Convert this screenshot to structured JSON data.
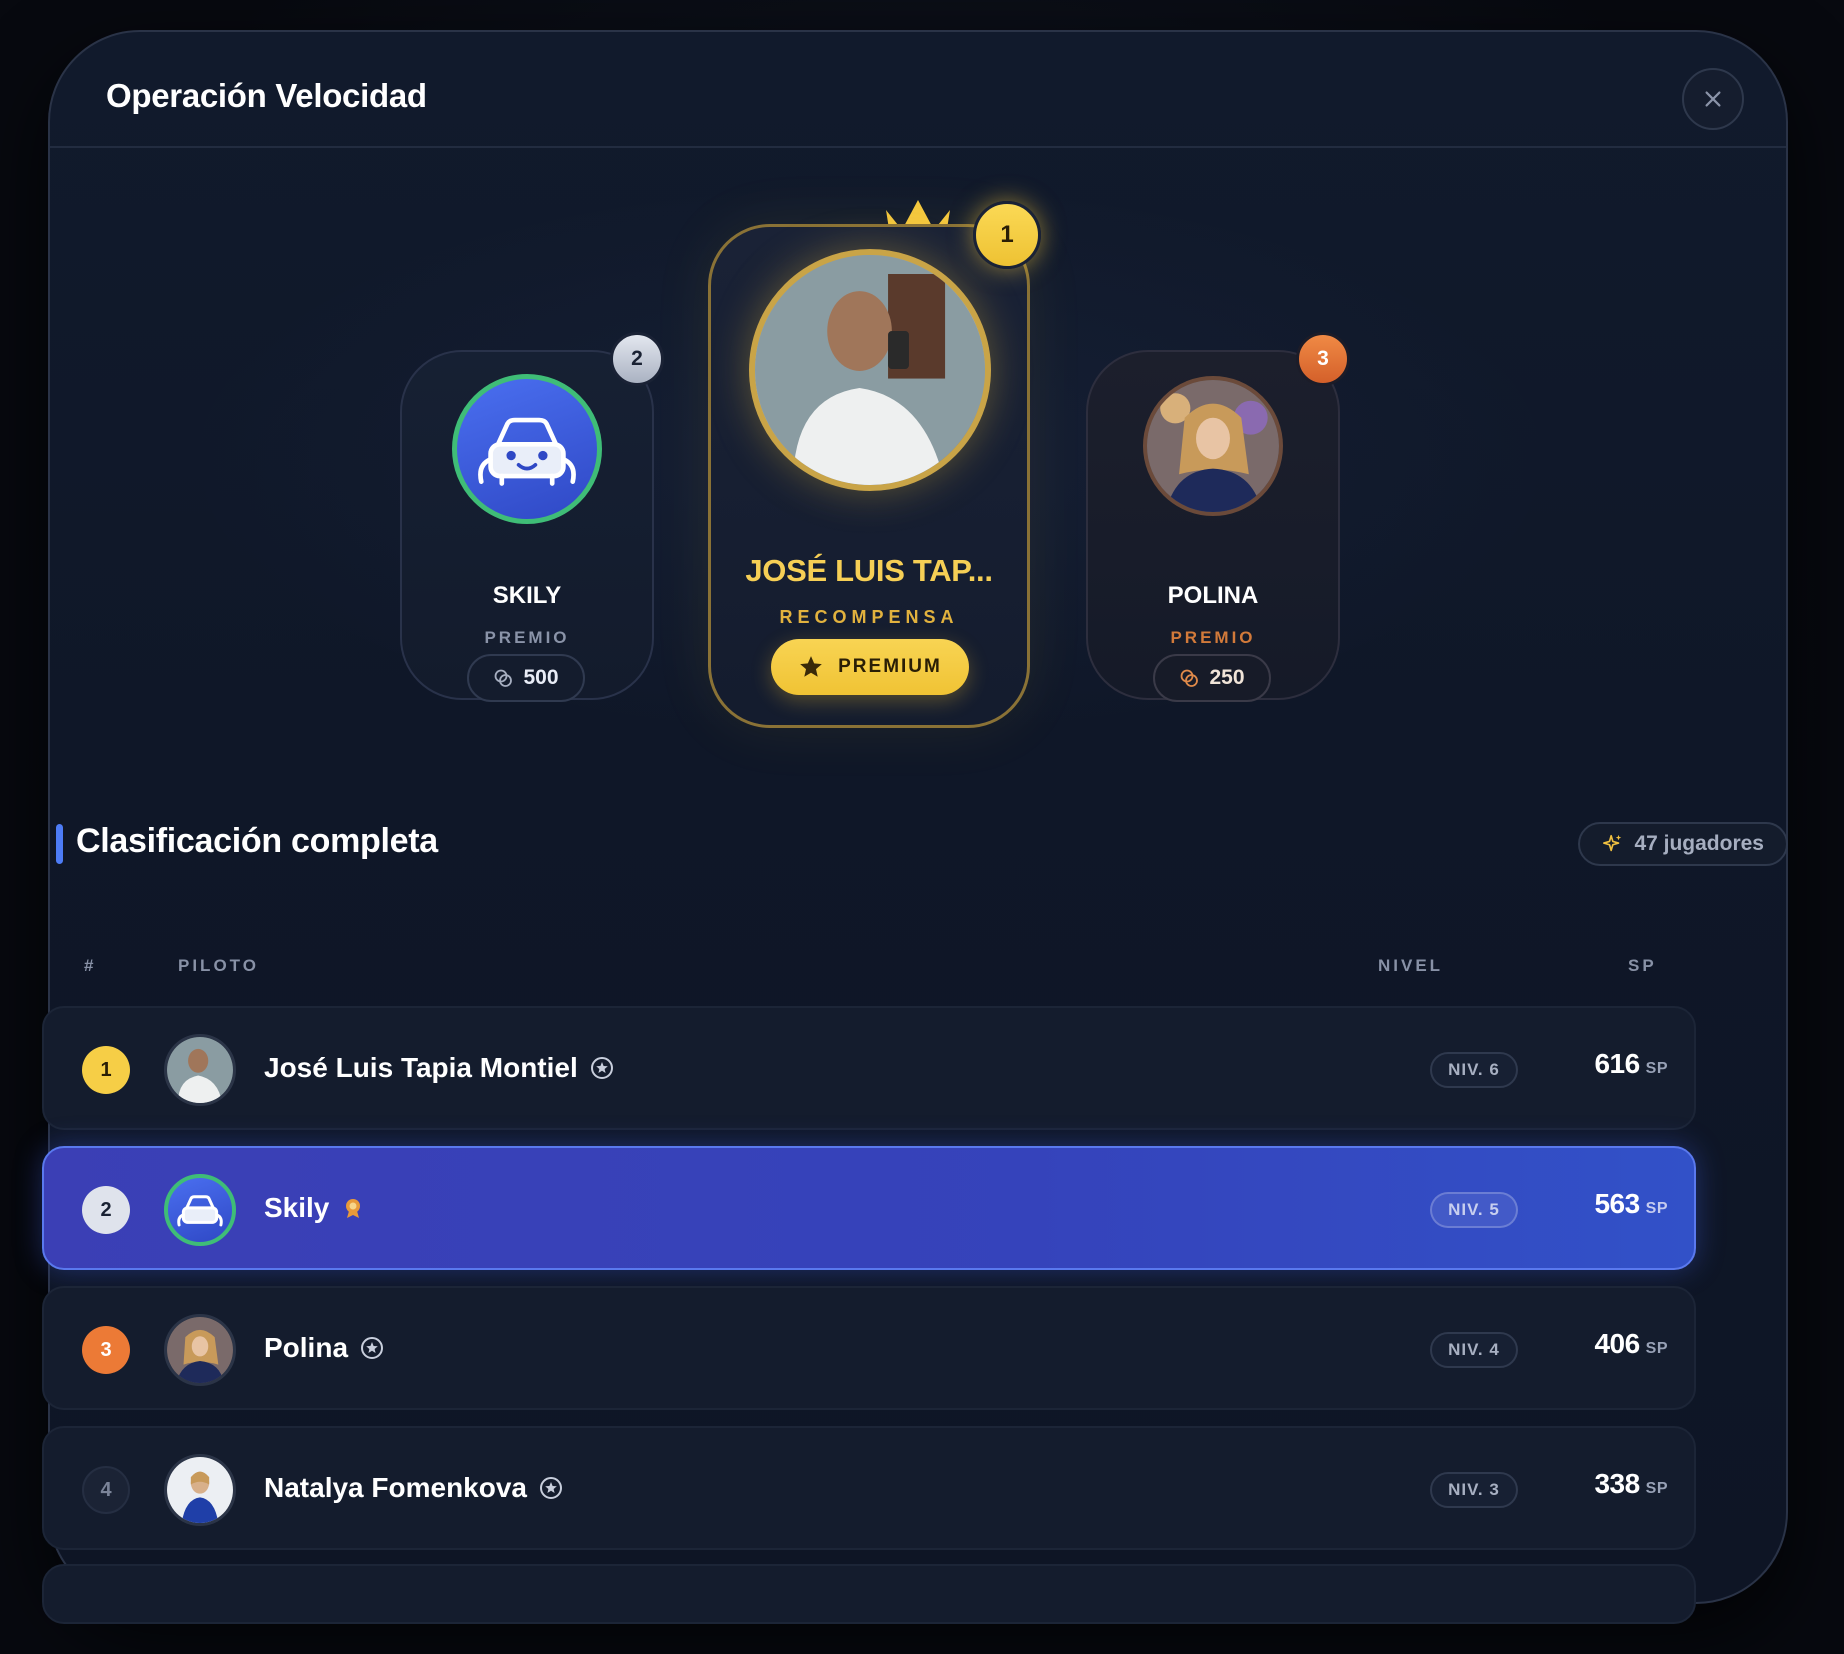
{
  "modal": {
    "title": "Operación Velocidad"
  },
  "podium": {
    "first": {
      "rank": "1",
      "name": "JOSÉ LUIS TAP...",
      "label": "RECOMPENSA",
      "reward": "PREMIUM"
    },
    "second": {
      "rank": "2",
      "name": "SKILY",
      "label": "PREMIO",
      "prize": "500"
    },
    "third": {
      "rank": "3",
      "name": "POLINA",
      "label": "PREMIO",
      "prize": "250"
    }
  },
  "leaderboard": {
    "title": "Clasificación completa",
    "players_count": "47 jugadores",
    "headers": {
      "rank": "#",
      "pilot": "PILOTO",
      "level": "NIVEL",
      "sp": "SP"
    },
    "rows": [
      {
        "rank": "1",
        "name": "José Luis Tapia Montiel",
        "level": "NIV. 6",
        "sp": "616",
        "unit": "SP",
        "badge": "star-badge-icon"
      },
      {
        "rank": "2",
        "name": "Skily",
        "level": "NIV. 5",
        "sp": "563",
        "unit": "SP",
        "badge": "medal-badge-icon"
      },
      {
        "rank": "3",
        "name": "Polina",
        "level": "NIV. 4",
        "sp": "406",
        "unit": "SP",
        "badge": "star-badge-icon"
      },
      {
        "rank": "4",
        "name": "Natalya Fomenkova",
        "level": "NIV. 3",
        "sp": "338",
        "unit": "SP",
        "badge": "star-badge-icon"
      }
    ]
  },
  "colors": {
    "gold": "#f6ce46",
    "silver": "#dfe3ec",
    "bronze": "#ec7a36",
    "accent": "#4d7cf6",
    "highlight_row": "#3b3fb5",
    "background": "#0f1728"
  }
}
